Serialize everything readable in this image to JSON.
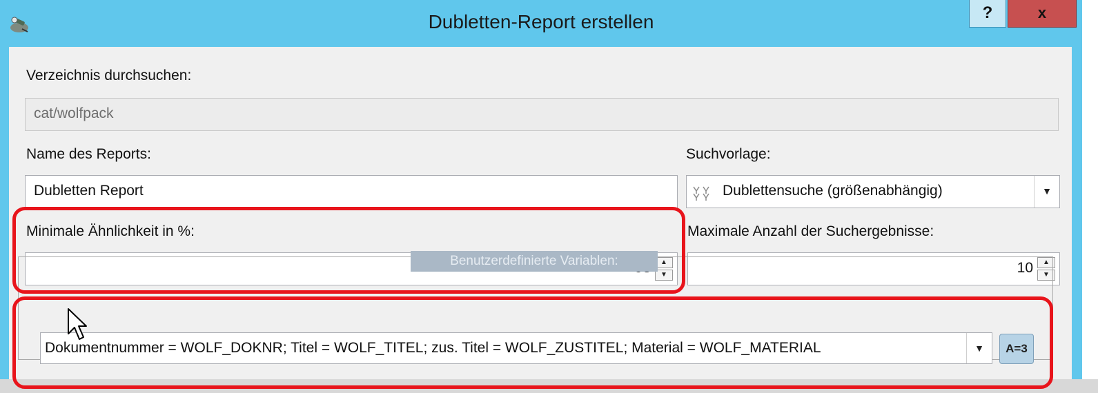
{
  "window": {
    "title": "Dubletten-Report erstellen",
    "help_label": "?",
    "close_label": "x",
    "titlebar_color": "#60c7ec"
  },
  "icons": {
    "app": "tools-icon",
    "search_template": "template-icon",
    "cursor": "mouse-pointer-icon"
  },
  "form": {
    "directory_label": "Verzeichnis durchsuchen:",
    "directory_value": "cat/wolfpack",
    "report_name_label": "Name des Reports:",
    "report_name_value": "Dubletten Report",
    "search_template_label": "Suchvorlage:",
    "search_template_value": "Dublettensuche (größenabhängig)",
    "min_similarity_label": "Minimale Ähnlichkeit in %:",
    "min_similarity_value": "98",
    "max_results_label": "Maximale Anzahl der Suchergebnisse:",
    "max_results_value": "10",
    "custom_vars_legend": "Benutzerdefinierte Variablen:",
    "custom_vars_value": "Dokumentnummer = WOLF_DOKNR; Titel = WOLF_TITEL; zus. Titel = WOLF_ZUSTITEL; Material = WOLF_MATERIAL",
    "a3_button_label": "A=3"
  },
  "highlight_color": "#e8141b"
}
